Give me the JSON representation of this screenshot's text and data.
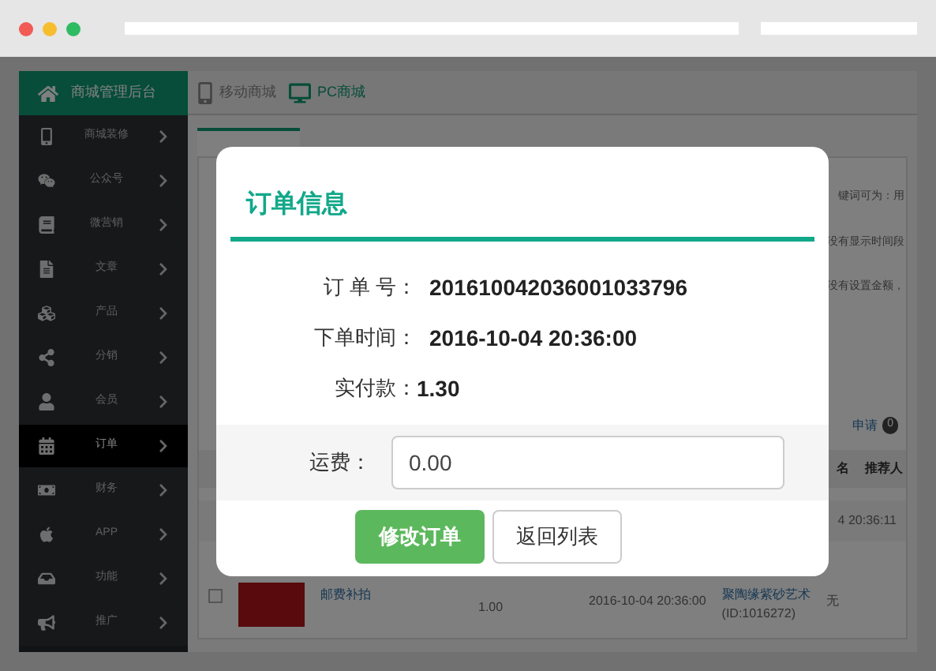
{
  "header": {
    "title": "商城管理后台",
    "links": [
      {
        "label": "移动商城",
        "kind": "mobile",
        "selected": false
      },
      {
        "label": "PC商城",
        "kind": "pc",
        "selected": true
      }
    ]
  },
  "sidebar": {
    "items": [
      {
        "label": "商城装修",
        "selected": false
      },
      {
        "label": "公众号",
        "selected": false
      },
      {
        "label": "微营销",
        "selected": false
      },
      {
        "label": "文章",
        "selected": false
      },
      {
        "label": "产品",
        "selected": false
      },
      {
        "label": "分销",
        "selected": false
      },
      {
        "label": "会员",
        "selected": false
      },
      {
        "label": "订单",
        "selected": true
      },
      {
        "label": "财务",
        "selected": false
      },
      {
        "label": "APP",
        "selected": false
      },
      {
        "label": "功能",
        "selected": false
      },
      {
        "label": "推广",
        "selected": false
      }
    ]
  },
  "background": {
    "notes": [
      "键词可为：用",
      "没有显示时间段",
      "没有设置金额，"
    ],
    "apply_link": "申请",
    "apply_count": "0",
    "columns": [
      "名",
      "推荐人"
    ],
    "row_1_time": "4 20:36:11",
    "row_2": {
      "checked": false,
      "product": "邮费补拍",
      "price": "1.00",
      "time": "2016-10-04 20:36:00",
      "shop": "聚陶缘紫砂艺术",
      "shop_id": "(ID:1016272)",
      "referrer": "无"
    }
  },
  "dialog": {
    "title": "订单信息",
    "fields": [
      {
        "label": "订 单 号：",
        "value": "201610042036001033796"
      },
      {
        "label": "下单时间：",
        "value": "2016-10-04 20:36:00"
      },
      {
        "label": "实付款：",
        "value": "1.30"
      }
    ],
    "fee": {
      "label": "运费：",
      "value": "0.00"
    },
    "buttons": [
      {
        "label": "修改订单",
        "kind": "primary"
      },
      {
        "label": "返回列表",
        "kind": "default"
      }
    ]
  }
}
